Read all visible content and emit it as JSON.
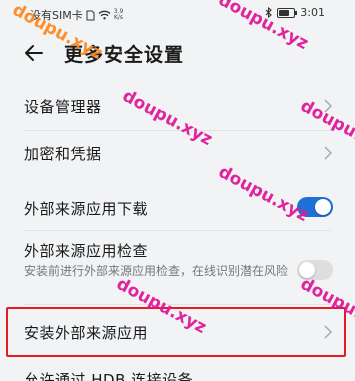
{
  "status_bar": {
    "carrier": "没有SIM卡",
    "speed_value": "3.9",
    "speed_unit": "K/s",
    "time": "3:01"
  },
  "header": {
    "title": "更多安全设置"
  },
  "items": {
    "device_manager": {
      "label": "设备管理器"
    },
    "encryption": {
      "label": "加密和凭据"
    },
    "external_download": {
      "label": "外部来源应用下载",
      "enabled": true
    },
    "external_check": {
      "label": "外部来源应用检查",
      "description": "安装前进行外部来源应用检查，在线识别潜在风险",
      "enabled": false
    },
    "install_external": {
      "label": "安装外部来源应用"
    },
    "hdb": {
      "label": "允许通过 HDB 连接设备"
    }
  },
  "watermark": {
    "text": "doupu.xyz"
  },
  "colors": {
    "accent": "#1f6fd6",
    "highlight": "#e01b24"
  }
}
